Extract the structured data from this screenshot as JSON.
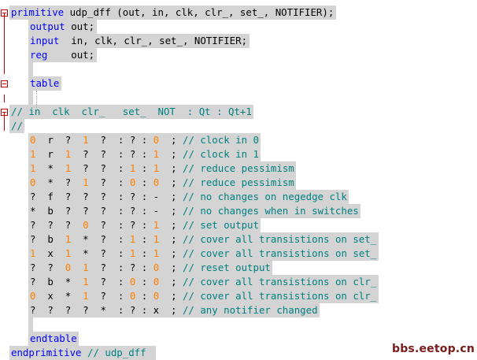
{
  "colors": {
    "keyword": "#0000ff",
    "comment": "#008080",
    "number": "#ff8000",
    "text": "#000000",
    "highlight": "#d4d4d4",
    "fold": "#cc0000",
    "watermark": "#7a1a1a"
  },
  "fold_icons": [
    "minus-box-icon",
    "minus-box-icon",
    "minus-box-icon"
  ],
  "lines": [
    {
      "indent": 0,
      "parts": [
        [
          "kw",
          "primitive"
        ],
        [
          "tx",
          " udp_dff (out, in, clk, clr_, set_, NOTIFIER);"
        ]
      ]
    },
    {
      "indent": 1,
      "parts": [
        [
          "kw",
          "output"
        ],
        [
          "tx",
          " out;"
        ]
      ]
    },
    {
      "indent": 1,
      "parts": [
        [
          "kw",
          "input"
        ],
        [
          "tx",
          "  in, clk, clr_, set_, NOTIFIER;"
        ]
      ]
    },
    {
      "indent": 1,
      "parts": [
        [
          "kw",
          "reg"
        ],
        [
          "tx",
          "    out;"
        ]
      ]
    },
    {
      "indent": 1,
      "parts": []
    },
    {
      "indent": 1,
      "parts": [
        [
          "kw",
          "table"
        ]
      ]
    },
    {
      "indent": 1,
      "parts": []
    },
    {
      "indent": 0,
      "parts": [
        [
          "cm",
          "// in  clk  clr_   set_  NOT  : Qt : Qt+1"
        ]
      ]
    },
    {
      "indent": 0,
      "parts": [
        [
          "cm",
          "//"
        ]
      ]
    },
    {
      "indent": 1,
      "parts": [
        [
          "nm",
          "0"
        ],
        [
          "tx",
          "  r  ? "
        ],
        [
          "nm",
          " 1"
        ],
        [
          "tx",
          "  ?  : ? : "
        ],
        [
          "nm",
          "0"
        ],
        [
          "tx",
          "  ; "
        ],
        [
          "cm",
          "// clock in 0"
        ]
      ]
    },
    {
      "indent": 1,
      "parts": [
        [
          "nm",
          "1"
        ],
        [
          "tx",
          "  r "
        ],
        [
          "nm",
          " 1"
        ],
        [
          "tx",
          "  ?  ?  : ? : "
        ],
        [
          "nm",
          "1"
        ],
        [
          "tx",
          "  ; "
        ],
        [
          "cm",
          "// clock in 1"
        ]
      ]
    },
    {
      "indent": 1,
      "parts": [
        [
          "nm",
          "1"
        ],
        [
          "tx",
          "  *  "
        ],
        [
          "nm",
          "1"
        ],
        [
          "tx",
          "  ?  ?  : "
        ],
        [
          "nm",
          "1"
        ],
        [
          "tx",
          " : "
        ],
        [
          "nm",
          "1"
        ],
        [
          "tx",
          "  ; "
        ],
        [
          "cm",
          "// reduce pessimism"
        ]
      ]
    },
    {
      "indent": 1,
      "parts": [
        [
          "nm",
          "0"
        ],
        [
          "tx",
          "  *  ?  "
        ],
        [
          "nm",
          "1"
        ],
        [
          "tx",
          "  ?  : "
        ],
        [
          "nm",
          "0"
        ],
        [
          "tx",
          " : "
        ],
        [
          "nm",
          "0"
        ],
        [
          "tx",
          "  ; "
        ],
        [
          "cm",
          "// reduce pessimism"
        ]
      ]
    },
    {
      "indent": 1,
      "parts": [
        [
          "tx",
          "?  f  ?  ?  ?  : ? : -  ; "
        ],
        [
          "cm",
          "// no changes on negedge clk"
        ]
      ]
    },
    {
      "indent": 1,
      "parts": [
        [
          "tx",
          "*  b  ?  ?  ?  : ? : -  ; "
        ],
        [
          "cm",
          "// no changes when in switches"
        ]
      ]
    },
    {
      "indent": 1,
      "parts": [
        [
          "tx",
          "?  ?  ?  "
        ],
        [
          "nm",
          "0"
        ],
        [
          "tx",
          "  ?  : ? : "
        ],
        [
          "nm",
          "1"
        ],
        [
          "tx",
          "  ; "
        ],
        [
          "cm",
          "// set output"
        ]
      ]
    },
    {
      "indent": 1,
      "parts": [
        [
          "tx",
          "?  b  "
        ],
        [
          "nm",
          "1"
        ],
        [
          "tx",
          "  *  ?  : "
        ],
        [
          "nm",
          "1"
        ],
        [
          "tx",
          " : "
        ],
        [
          "nm",
          "1"
        ],
        [
          "tx",
          "  ; "
        ],
        [
          "cm",
          "// cover all transistions on set_"
        ]
      ]
    },
    {
      "indent": 1,
      "parts": [
        [
          "nm",
          "1"
        ],
        [
          "tx",
          "  x  "
        ],
        [
          "nm",
          "1"
        ],
        [
          "tx",
          "  *  ?  : "
        ],
        [
          "nm",
          "1"
        ],
        [
          "tx",
          " : "
        ],
        [
          "nm",
          "1"
        ],
        [
          "tx",
          "  ; "
        ],
        [
          "cm",
          "// cover all transistions on set_"
        ]
      ]
    },
    {
      "indent": 1,
      "parts": [
        [
          "tx",
          "?  ?  "
        ],
        [
          "nm",
          "0"
        ],
        [
          "tx",
          "  "
        ],
        [
          "nm",
          "1"
        ],
        [
          "tx",
          "  ?  : ? : "
        ],
        [
          "nm",
          "0"
        ],
        [
          "tx",
          "  ; "
        ],
        [
          "cm",
          "// reset output"
        ]
      ]
    },
    {
      "indent": 1,
      "parts": [
        [
          "tx",
          "?  b  *  "
        ],
        [
          "nm",
          "1"
        ],
        [
          "tx",
          "  ?  : "
        ],
        [
          "nm",
          "0"
        ],
        [
          "tx",
          " : "
        ],
        [
          "nm",
          "0"
        ],
        [
          "tx",
          "  ; "
        ],
        [
          "cm",
          "// cover all transistions on clr_"
        ]
      ]
    },
    {
      "indent": 1,
      "parts": [
        [
          "nm",
          "0"
        ],
        [
          "tx",
          "  x  *  "
        ],
        [
          "nm",
          "1"
        ],
        [
          "tx",
          "  ?  : "
        ],
        [
          "nm",
          "0"
        ],
        [
          "tx",
          " : "
        ],
        [
          "nm",
          "0"
        ],
        [
          "tx",
          "  ; "
        ],
        [
          "cm",
          "// cover all transistions on clr_"
        ]
      ]
    },
    {
      "indent": 1,
      "parts": [
        [
          "tx",
          "?  ?  ?  ?  *  : ? : x  ; "
        ],
        [
          "cm",
          "// any notifier changed"
        ]
      ]
    },
    {
      "indent": 1,
      "parts": []
    },
    {
      "indent": 1,
      "parts": [
        [
          "kw",
          "endtable"
        ]
      ]
    },
    {
      "indent": 0,
      "parts": [
        [
          "kw",
          "endprimitive"
        ],
        [
          "tx",
          " "
        ],
        [
          "cm",
          "// udp_dff"
        ]
      ]
    }
  ],
  "watermark": "bbs.eetop.cn"
}
